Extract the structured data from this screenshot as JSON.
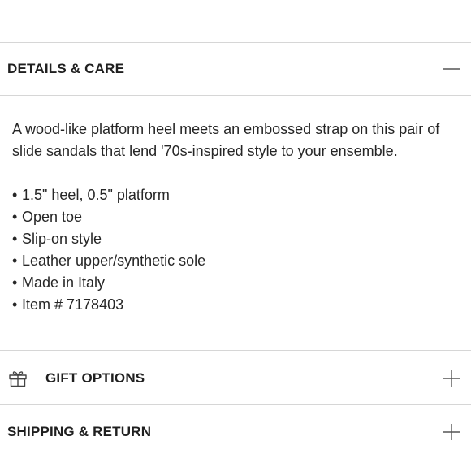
{
  "details": {
    "title": "DETAILS & CARE",
    "toggle_icon": "minus-icon",
    "description": "A wood-like platform heel meets an embossed strap on this pair of slide sandals that lend '70s-inspired style to your ensemble.",
    "features": [
      "1.5\" heel, 0.5\" platform",
      "Open toe",
      "Slip-on style",
      "Leather upper/synthetic sole",
      "Made in Italy",
      "Item # 7178403"
    ]
  },
  "gift": {
    "title": "GIFT OPTIONS",
    "icon": "gift-icon",
    "toggle_icon": "plus-icon"
  },
  "shipping": {
    "title": "SHIPPING & RETURN",
    "toggle_icon": "plus-icon"
  },
  "colors": {
    "text": "#222222",
    "divider": "#d6d6d6",
    "icon": "#555555"
  }
}
